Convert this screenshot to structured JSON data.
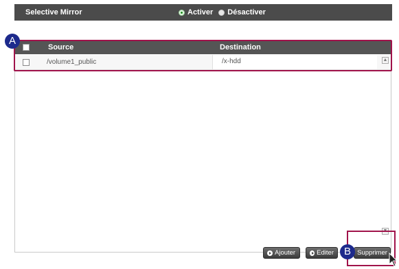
{
  "header": {
    "title": "Selective Mirror",
    "options": [
      {
        "label": "Activer",
        "selected": true
      },
      {
        "label": "Désactiver",
        "selected": false
      }
    ]
  },
  "table": {
    "columns": [
      "Source",
      "Destination"
    ],
    "rows": [
      {
        "source": "/volume1_public",
        "destination": "/x-hdd"
      }
    ]
  },
  "buttons": {
    "add": "Ajouter",
    "edit": "Editer",
    "delete": "Supprimer"
  },
  "callouts": {
    "a": "A",
    "b": "B"
  },
  "colors": {
    "header_bg": "#4b4b4b",
    "highlight": "#a0124a",
    "callout_bg": "#1d2a8c"
  }
}
